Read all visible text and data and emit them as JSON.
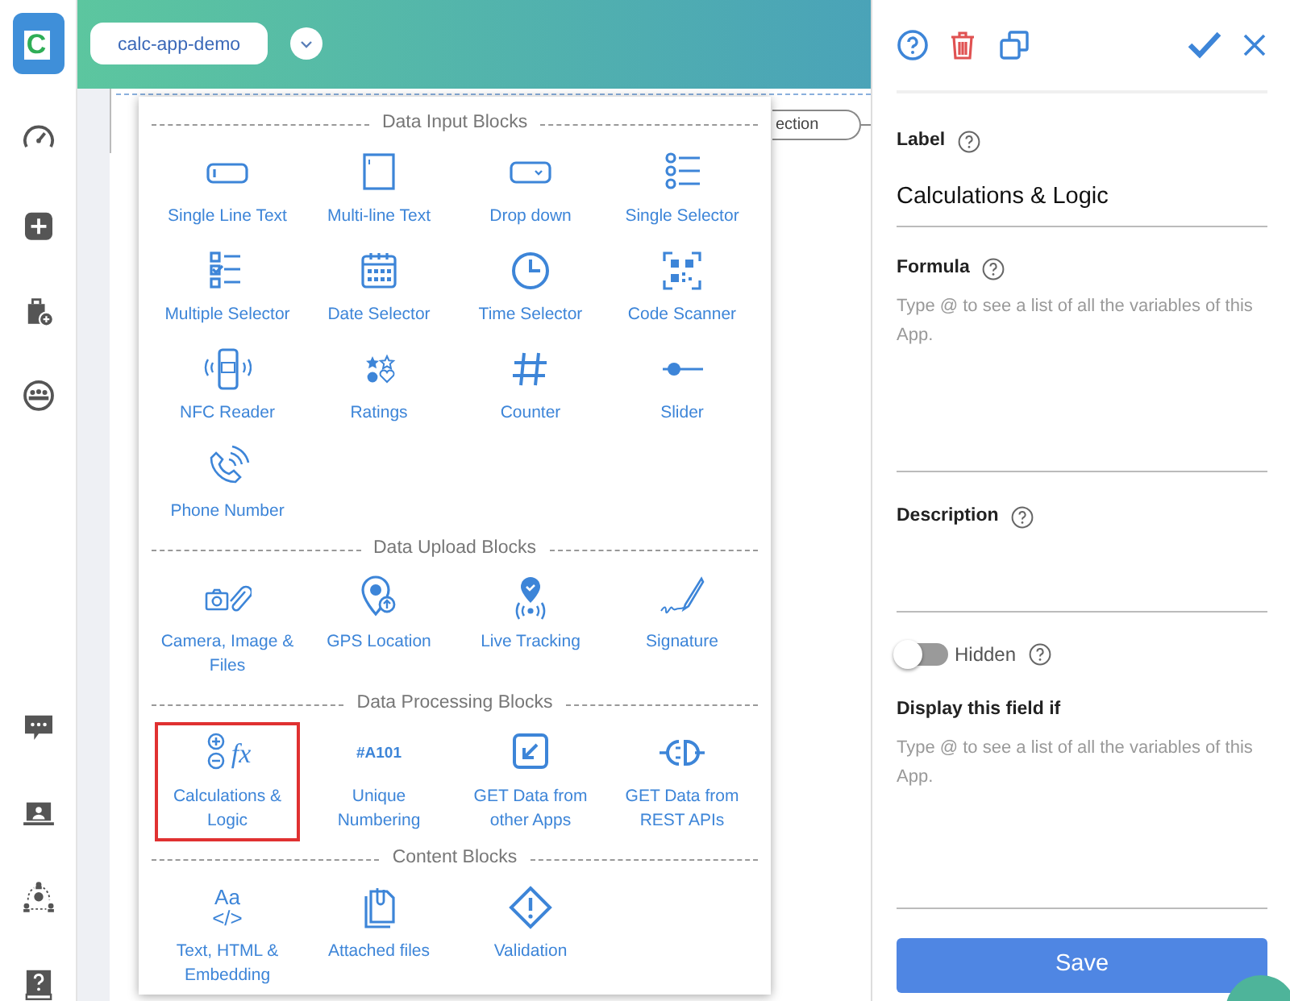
{
  "app_bar": {
    "logo_text": "C",
    "app_name": "calc-app-demo"
  },
  "canvas": {
    "partial_button": "ection"
  },
  "block_palette": {
    "sections": [
      {
        "title": "Data Input Blocks",
        "blocks": [
          {
            "kind": "single-line",
            "label": "Single Line Text",
            "selected": false
          },
          {
            "kind": "multi-line",
            "label": "Multi-line Text",
            "selected": false
          },
          {
            "kind": "dropdown",
            "label": "Drop down",
            "selected": false
          },
          {
            "kind": "single-selector",
            "label": "Single Selector",
            "selected": false
          },
          {
            "kind": "multi-selector",
            "label": "Multiple Selector",
            "selected": false
          },
          {
            "kind": "date",
            "label": "Date Selector",
            "selected": false
          },
          {
            "kind": "time",
            "label": "Time Selector",
            "selected": false
          },
          {
            "kind": "code-scanner",
            "label": "Code Scanner",
            "selected": false
          },
          {
            "kind": "nfc",
            "label": "NFC Reader",
            "selected": false
          },
          {
            "kind": "ratings",
            "label": "Ratings",
            "selected": false
          },
          {
            "kind": "counter",
            "label": "Counter",
            "selected": false
          },
          {
            "kind": "slider",
            "label": "Slider",
            "selected": false
          },
          {
            "kind": "phone",
            "label": "Phone Number",
            "selected": false
          }
        ]
      },
      {
        "title": "Data Upload Blocks",
        "blocks": [
          {
            "kind": "camera",
            "label": "Camera, Image & Files",
            "selected": false
          },
          {
            "kind": "gps",
            "label": "GPS Location",
            "selected": false
          },
          {
            "kind": "tracking",
            "label": "Live Tracking",
            "selected": false
          },
          {
            "kind": "signature",
            "label": "Signature",
            "selected": false
          }
        ]
      },
      {
        "title": "Data Processing Blocks",
        "blocks": [
          {
            "kind": "calc",
            "label": "Calculations & Logic",
            "icon_lines": [
              "fx"
            ],
            "selected": true
          },
          {
            "kind": "text-icon",
            "label": "Unique Numbering",
            "icon_lines": [
              "#A101"
            ],
            "selected": false
          },
          {
            "kind": "get-apps",
            "label": "GET Data from other Apps",
            "selected": false
          },
          {
            "kind": "rest",
            "label": "GET Data from REST APIs",
            "selected": false
          }
        ]
      },
      {
        "title": "Content Blocks",
        "blocks": [
          {
            "kind": "text-icon",
            "label": "Text, HTML & Embedding",
            "icon_lines": [
              "Aa",
              "</>"
            ],
            "selected": false
          },
          {
            "kind": "attached",
            "label": "Attached files",
            "selected": false
          },
          {
            "kind": "validation",
            "label": "Validation",
            "selected": false
          }
        ]
      }
    ]
  },
  "properties_panel": {
    "label_field": {
      "label": "Label",
      "value": "Calculations & Logic"
    },
    "formula_field": {
      "label": "Formula",
      "placeholder": "Type @ to see a list of all the variables of this App."
    },
    "description_field": {
      "label": "Description"
    },
    "hidden_toggle": {
      "label": "Hidden",
      "on": false
    },
    "condition_field": {
      "label": "Display this field if",
      "placeholder": "Type @ to see a list of all the variables of this App."
    },
    "save_button": "Save"
  }
}
